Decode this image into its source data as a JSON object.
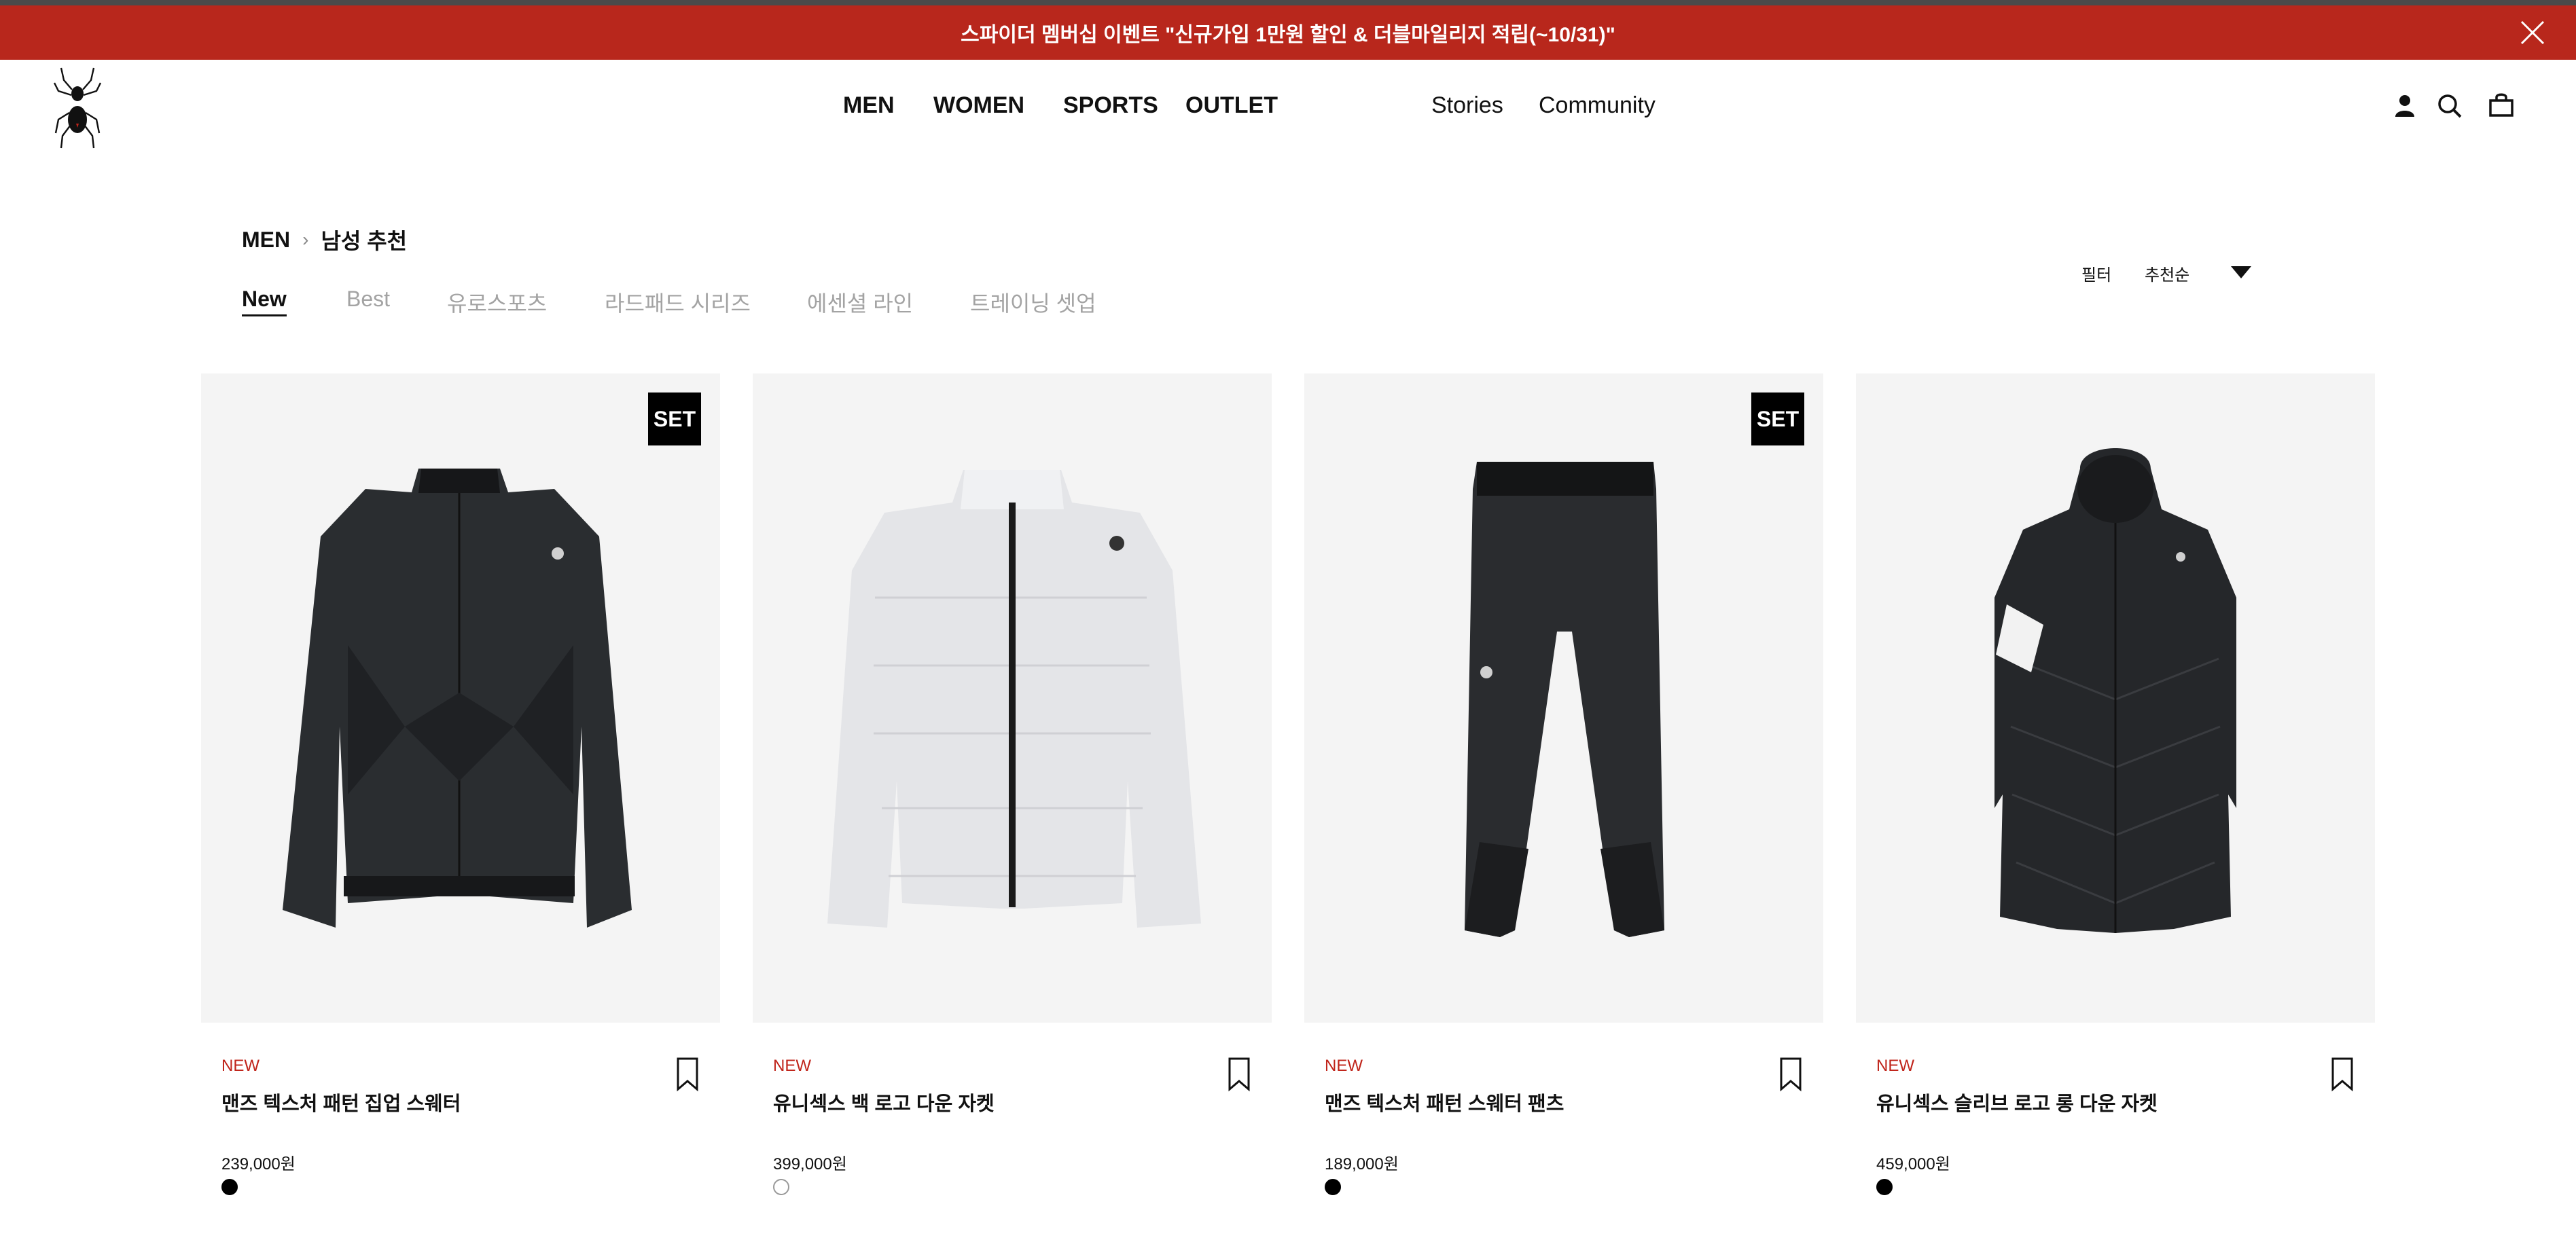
{
  "promo": {
    "text": "스파이더 멤버십 이벤트 \"신규가입 1만원 할인 & 더블마일리지 적립(~10/31)\"",
    "bg_color": "#b8271c"
  },
  "header": {
    "nav": [
      "MEN",
      "WOMEN",
      "SPORTS",
      "OUTLET"
    ],
    "nav_secondary": [
      "Stories",
      "Community"
    ],
    "icons": [
      "user-icon",
      "search-icon",
      "cart-icon"
    ]
  },
  "breadcrumb": {
    "root": "MEN",
    "current": "남성 추천"
  },
  "tabs": [
    {
      "label": "New",
      "active": true
    },
    {
      "label": "Best",
      "active": false
    },
    {
      "label": "유로스포츠",
      "active": false
    },
    {
      "label": "라드패드 시리즈",
      "active": false
    },
    {
      "label": "에센셜 라인",
      "active": false
    },
    {
      "label": "트레이닝 셋업",
      "active": false
    }
  ],
  "toolbar": {
    "filter_label": "필터",
    "sort_label": "추천순"
  },
  "products": [
    {
      "badge": "NEW",
      "name": "맨즈 텍스처 패턴 집업 스웨터",
      "price": "239,000원",
      "set_label": "SET",
      "swatch": "#000000"
    },
    {
      "badge": "NEW",
      "name": "유니섹스 백 로고 다운 자켓",
      "price": "399,000원",
      "set_label": "",
      "swatch": "#ffffff"
    },
    {
      "badge": "NEW",
      "name": "맨즈 텍스처 패턴 스웨터 팬츠",
      "price": "189,000원",
      "set_label": "SET",
      "swatch": "#000000"
    },
    {
      "badge": "NEW",
      "name": "유니섹스 슬리브 로고 롱 다운 자켓",
      "price": "459,000원",
      "set_label": "",
      "swatch": "#000000"
    }
  ]
}
